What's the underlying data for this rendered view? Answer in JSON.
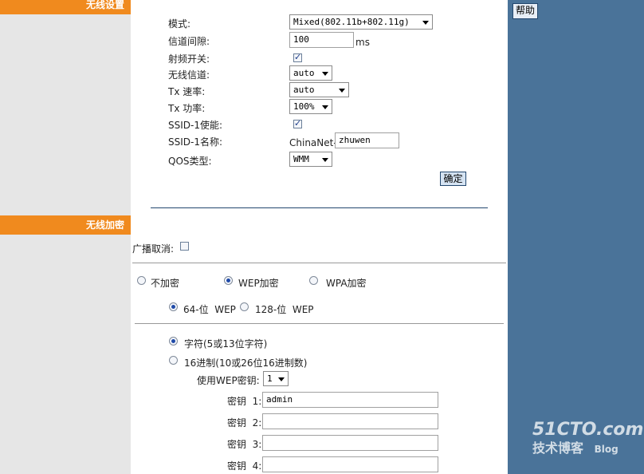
{
  "help_label": "帮助",
  "wireless_settings": {
    "header": "无线设置",
    "mode": {
      "label": "模式:",
      "value": "Mixed(802.11b+802.11g)"
    },
    "beacon": {
      "label": "信道间隙:",
      "value": "100",
      "unit": "ms"
    },
    "radio_switch": {
      "label": "射频开关:",
      "checked": true
    },
    "channel": {
      "label": "无线信道:",
      "value": "auto"
    },
    "tx_rate": {
      "label": "Tx 速率:",
      "value": "auto"
    },
    "tx_power": {
      "label": "Tx 功率:",
      "value": "100%"
    },
    "ssid1_enable": {
      "label": "SSID-1使能:",
      "checked": true
    },
    "ssid1_name": {
      "label": "SSID-1名称:",
      "prefix": "ChinaNet-",
      "value": "zhuwen"
    },
    "qos": {
      "label": "QOS类型:",
      "value": "WMM"
    },
    "confirm_label": "确定"
  },
  "wireless_encryption": {
    "header": "无线加密",
    "broadcast_cancel": {
      "label": "广播取消:",
      "checked": false
    },
    "modes": [
      {
        "label": "不加密",
        "checked": false
      },
      {
        "label": "WEP加密",
        "checked": true
      },
      {
        "label": "WPA加密",
        "checked": false
      }
    ],
    "wep_bits": [
      {
        "label": "64-位  WEP",
        "checked": true
      },
      {
        "label": "128-位  WEP",
        "checked": false
      }
    ],
    "key_format": [
      {
        "label": "字符(5或13位字符)",
        "checked": true
      },
      {
        "label": "16进制(10或26位16进制数)",
        "checked": false
      }
    ],
    "use_key": {
      "label": "使用WEP密钥:",
      "value": "1"
    },
    "keys": [
      {
        "label": "密钥  1:",
        "value": "admin"
      },
      {
        "label": "密钥  2:",
        "value": ""
      },
      {
        "label": "密钥  3:",
        "value": ""
      },
      {
        "label": "密钥  4:",
        "value": ""
      }
    ]
  },
  "watermark": {
    "line1": "51CTO.com",
    "line2": "技术博客",
    "line3": "Blog"
  }
}
